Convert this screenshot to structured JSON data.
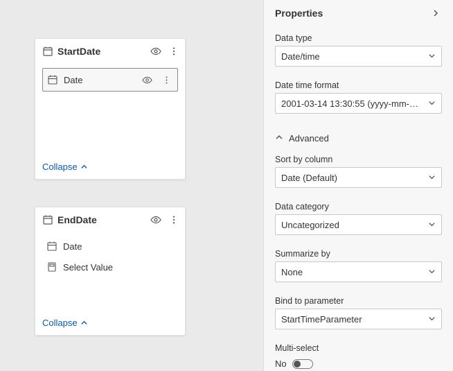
{
  "cards": [
    {
      "title": "StartDate",
      "collapse": "Collapse",
      "fields": [
        {
          "label": "Date",
          "selected": true
        }
      ]
    },
    {
      "title": "EndDate",
      "collapse": "Collapse",
      "fields": [
        {
          "label": "Date",
          "selected": false
        },
        {
          "label": "Select Value",
          "selected": false,
          "icon": "measure"
        }
      ]
    }
  ],
  "panel": {
    "title": "Properties",
    "data_type_label": "Data type",
    "data_type_value": "Date/time",
    "dt_format_label": "Date time format",
    "dt_format_value": "2001-03-14 13:30:55 (yyyy-mm-dd hh:n…",
    "advanced_label": "Advanced",
    "sort_label": "Sort by column",
    "sort_value": "Date (Default)",
    "category_label": "Data category",
    "category_value": "Uncategorized",
    "summarize_label": "Summarize by",
    "summarize_value": "None",
    "bind_label": "Bind to parameter",
    "bind_value": "StartTimeParameter",
    "multi_label": "Multi-select",
    "multi_value": "No"
  }
}
